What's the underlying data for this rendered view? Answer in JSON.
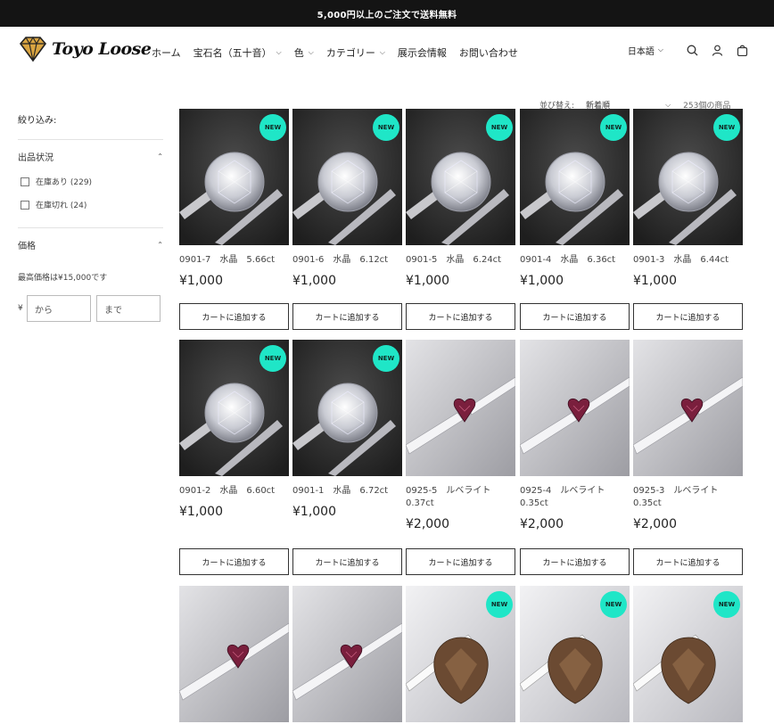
{
  "announcement": "5,000円以上のご注文で送料無料",
  "brand": {
    "logo_text": "Toyo Loose"
  },
  "nav": [
    {
      "label": "ホーム",
      "dropdown": false
    },
    {
      "label": "宝石名（五十音）",
      "dropdown": true
    },
    {
      "label": "色",
      "dropdown": true
    },
    {
      "label": "カテゴリー",
      "dropdown": true
    },
    {
      "label": "展示会情報",
      "dropdown": false
    },
    {
      "label": "お問い合わせ",
      "dropdown": false
    }
  ],
  "header_right": {
    "language": "日本語",
    "icons": [
      "search-icon",
      "account-icon",
      "cart-icon"
    ]
  },
  "filters": {
    "title": "絞り込み:",
    "availability": {
      "label": "出品状況",
      "options": [
        "在庫あり (229)",
        "在庫切れ (24)"
      ]
    },
    "price": {
      "label": "価格",
      "note": "最高価格は¥15,000です",
      "currency": "¥",
      "from_placeholder": "から",
      "to_placeholder": "まで"
    }
  },
  "sort": {
    "label": "並び替え:",
    "value": "新着順",
    "count": "253個の商品"
  },
  "cart_label": "カートに追加する",
  "new_badge": "NEW",
  "colors": {
    "badge": "#1fe6c7",
    "announcement_bg": "#141414"
  },
  "products": [
    {
      "title": "0901-7　水晶　5.66ct",
      "price": "¥1,000",
      "new": true,
      "stone": "crystal"
    },
    {
      "title": "0901-6　水晶　6.12ct",
      "price": "¥1,000",
      "new": true,
      "stone": "crystal"
    },
    {
      "title": "0901-5　水晶　6.24ct",
      "price": "¥1,000",
      "new": true,
      "stone": "crystal"
    },
    {
      "title": "0901-4　水晶　6.36ct",
      "price": "¥1,000",
      "new": true,
      "stone": "crystal"
    },
    {
      "title": "0901-3　水晶　6.44ct",
      "price": "¥1,000",
      "new": true,
      "stone": "crystal"
    },
    {
      "title": "0901-2　水晶　6.60ct",
      "price": "¥1,000",
      "new": true,
      "stone": "crystal"
    },
    {
      "title": "0901-1　水晶　6.72ct",
      "price": "¥1,000",
      "new": true,
      "stone": "crystal"
    },
    {
      "title": "0925-5　ルベライト　0.37ct",
      "price": "¥2,000",
      "new": false,
      "stone": "rubellite"
    },
    {
      "title": "0925-4　ルベライト　0.35ct",
      "price": "¥2,000",
      "new": false,
      "stone": "rubellite"
    },
    {
      "title": "0925-3　ルベライト　0.35ct",
      "price": "¥2,000",
      "new": false,
      "stone": "rubellite"
    },
    {
      "title": "",
      "price": "",
      "new": false,
      "stone": "rubellite"
    },
    {
      "title": "",
      "price": "",
      "new": false,
      "stone": "rubellite"
    },
    {
      "title": "",
      "price": "",
      "new": true,
      "stone": "smoky"
    },
    {
      "title": "",
      "price": "",
      "new": true,
      "stone": "smoky"
    },
    {
      "title": "",
      "price": "",
      "new": true,
      "stone": "smoky"
    }
  ]
}
